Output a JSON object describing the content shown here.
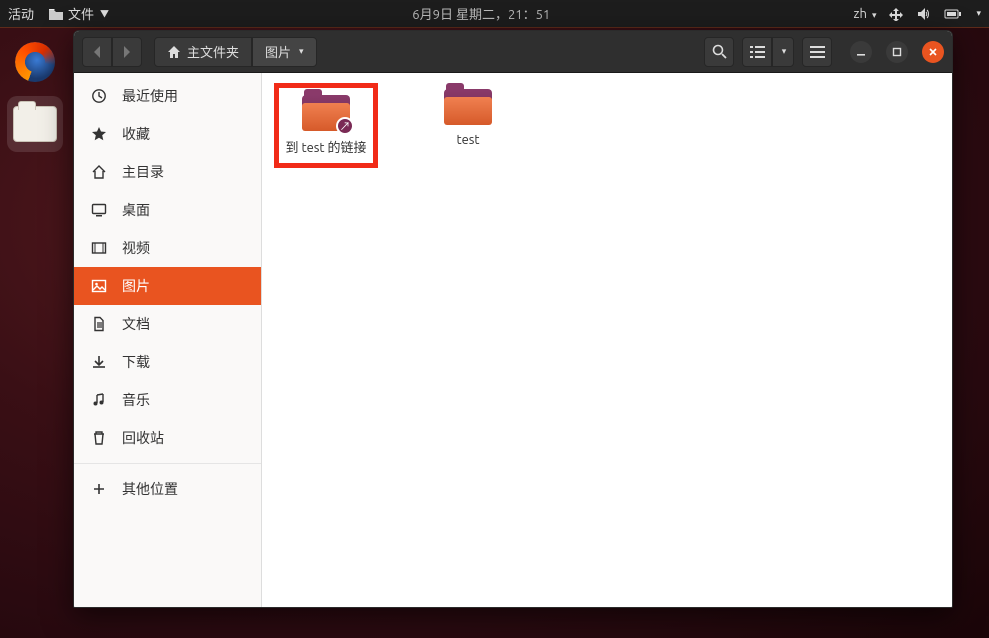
{
  "topbar": {
    "activities": "活动",
    "app_menu": "文件",
    "datetime": "6月9日 星期二，21：51",
    "input_method": "zh"
  },
  "headerbar": {
    "path_home": "主文件夹",
    "path_current": "图片"
  },
  "sidebar": {
    "items": [
      {
        "id": "recent",
        "label": "最近使用"
      },
      {
        "id": "starred",
        "label": "收藏"
      },
      {
        "id": "home",
        "label": "主目录"
      },
      {
        "id": "desktop",
        "label": "桌面"
      },
      {
        "id": "videos",
        "label": "视频"
      },
      {
        "id": "pictures",
        "label": "图片"
      },
      {
        "id": "documents",
        "label": "文档"
      },
      {
        "id": "downloads",
        "label": "下载"
      },
      {
        "id": "music",
        "label": "音乐"
      },
      {
        "id": "trash",
        "label": "回收站"
      }
    ],
    "other": "其他位置",
    "active_id": "pictures"
  },
  "files": [
    {
      "name": "到 test 的链接",
      "is_link": true,
      "highlighted": true
    },
    {
      "name": "test",
      "is_link": false,
      "highlighted": false
    }
  ]
}
